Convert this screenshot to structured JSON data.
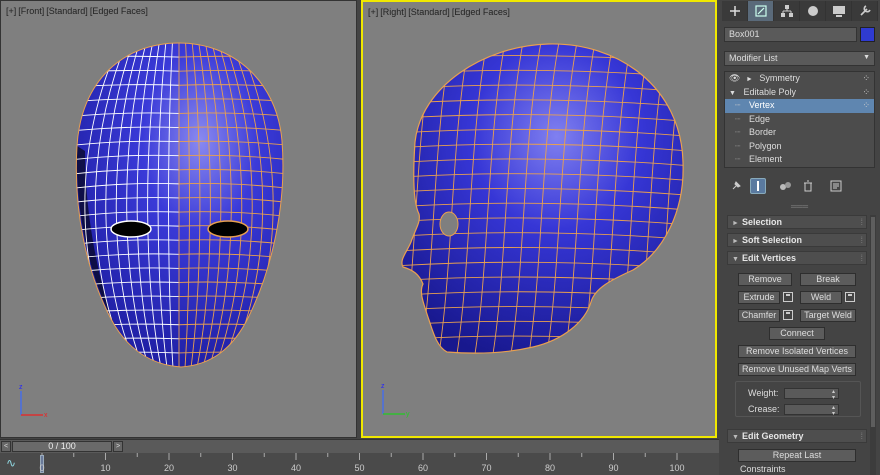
{
  "viewports": [
    {
      "id": "front",
      "label": [
        "[+]",
        "[Front]",
        "[Standard]",
        "[Edged Faces]"
      ],
      "mesh_color": "#2f2fd0",
      "active": false
    },
    {
      "id": "right",
      "label": [
        "[+]",
        "[Right]",
        "[Standard]",
        "[Edged Faces]"
      ],
      "mesh_color": "#2f2fd0",
      "active": true
    }
  ],
  "colors": {
    "viewport_bg": "#7f7f7f",
    "active_border": "#f0e800",
    "mesh": "#2f2fd0",
    "edge_white": "#ffffff",
    "edge_orange": "#e8a050",
    "selection_blue": "#5f86b0"
  },
  "command_panel": {
    "tabs": [
      {
        "icon": "create-plus-icon"
      },
      {
        "icon": "modify-icon",
        "active": true
      },
      {
        "icon": "hierarchy-icon"
      },
      {
        "icon": "motion-icon"
      },
      {
        "icon": "display-icon"
      },
      {
        "icon": "utilities-icon"
      }
    ],
    "object_name": "Box001",
    "object_color": "#2f3bd1",
    "modifier_list": "Modifier List",
    "stack": [
      {
        "label": "Symmetry",
        "level": 0,
        "eye": true,
        "expand": "►"
      },
      {
        "label": "Editable Poly",
        "level": 0,
        "expand": "▼"
      },
      {
        "label": "Vertex",
        "level": 1,
        "selected": true
      },
      {
        "label": "Edge",
        "level": 1
      },
      {
        "label": "Border",
        "level": 1
      },
      {
        "label": "Polygon",
        "level": 1
      },
      {
        "label": "Element",
        "level": 1
      }
    ],
    "rollouts": {
      "selection": "Selection",
      "soft_selection": "Soft Selection",
      "edit_vertices": "Edit Vertices",
      "edit_geometry": "Edit Geometry"
    },
    "buttons": {
      "remove": "Remove",
      "break": "Break",
      "extrude": "Extrude",
      "weld": "Weld",
      "chamfer": "Chamfer",
      "target_weld": "Target Weld",
      "connect": "Connect",
      "remove_isolated": "Remove Isolated Vertices",
      "remove_unused": "Remove Unused Map Verts",
      "repeat_last": "Repeat Last",
      "constraints": "Constraints"
    },
    "weight_label": "Weight:",
    "crease_label": "Crease:",
    "separator": "═══"
  },
  "timeline": {
    "frame_counter": "0 / 100",
    "prev": "<",
    "next": ">",
    "ticks": [
      "0",
      "10",
      "20",
      "30",
      "40",
      "50",
      "60",
      "70",
      "80",
      "90",
      "100"
    ]
  },
  "gizmo": {
    "x": "x",
    "y": "y",
    "z": "z"
  }
}
